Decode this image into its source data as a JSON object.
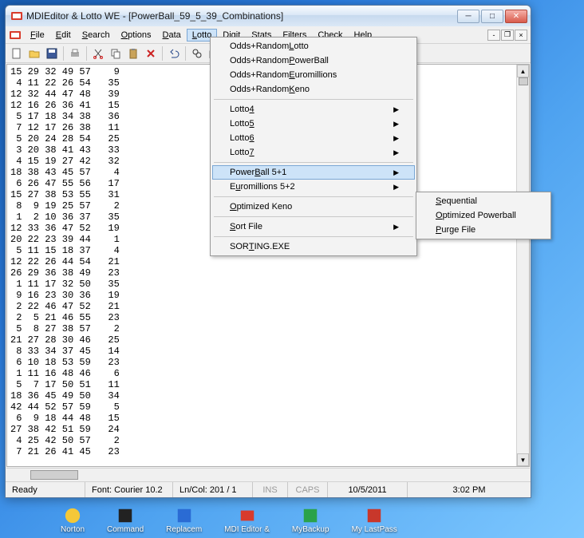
{
  "window": {
    "title": "MDIEditor & Lotto WE - [PowerBall_59_5_39_Combinations]"
  },
  "menubar": {
    "items": [
      "File",
      "Edit",
      "Search",
      "Options",
      "Data",
      "Lotto",
      "Digit",
      "Stats",
      "Filters",
      "Check",
      "Help"
    ],
    "active_index": 5
  },
  "lotto_menu": {
    "odds_lotto": "Odds+Random Lotto",
    "odds_powerball": "Odds+Random PowerBall",
    "odds_euro": "Odds+Random Euromillions",
    "odds_keno": "Odds+Random Keno",
    "lotto4": "Lotto 4",
    "lotto5": "Lotto 5",
    "lotto6": "Lotto 6",
    "lotto7": "Lotto 7",
    "powerball51": "PowerBall 5+1",
    "euro52": "Euromillions 5+2",
    "opt_keno": "Optimized Keno",
    "sort_file": "Sort File",
    "sorting_exe": "SORTING.EXE"
  },
  "powerball_submenu": {
    "sequential": "Sequential",
    "optimized": "Optimized Powerball",
    "purge": "Purge File"
  },
  "document": {
    "lines": [
      "15 29 32 49 57    9",
      " 4 11 22 26 54   35",
      "12 32 44 47 48   39",
      "12 16 26 36 41   15",
      " 5 17 18 34 38   36",
      " 7 12 17 26 38   11",
      " 5 20 24 28 54   25",
      " 3 20 38 41 43   33",
      " 4 15 19 27 42   32",
      "18 38 43 45 57    4",
      " 6 26 47 55 56   17",
      "15 27 38 53 55   31",
      " 8  9 19 25 57    2",
      " 1  2 10 36 37   35",
      "12 33 36 47 52   19",
      "20 22 23 39 44    1",
      " 5 11 15 18 37    4",
      "12 22 26 44 54   21",
      "26 29 36 38 49   23",
      " 1 11 17 32 50   35",
      " 9 16 23 30 36   19",
      " 2 22 46 47 52   21",
      " 2  5 21 46 55   23",
      " 5  8 27 38 57    2",
      "21 27 28 30 46   25",
      " 8 33 34 37 45   14",
      " 6 10 18 53 59   23",
      " 1 11 16 48 46    6",
      " 5  7 17 50 51   11",
      "18 36 45 49 50   34",
      "42 44 52 57 59    5",
      " 6  9 18 44 48   15",
      "27 38 42 51 59   24",
      " 4 25 42 50 57    2",
      " 7 21 26 41 45   23"
    ]
  },
  "statusbar": {
    "ready": "Ready",
    "font": "Font: Courier 10.2",
    "lncol": "Ln/Col: 201 / 1",
    "ins": "INS",
    "caps": "CAPS",
    "date": "10/5/2011",
    "time": "3:02 PM"
  },
  "taskbar": {
    "items": [
      "Norton",
      "Command",
      "Replacem",
      "MDI Editor &",
      "MyBackup",
      "My LastPass"
    ]
  }
}
